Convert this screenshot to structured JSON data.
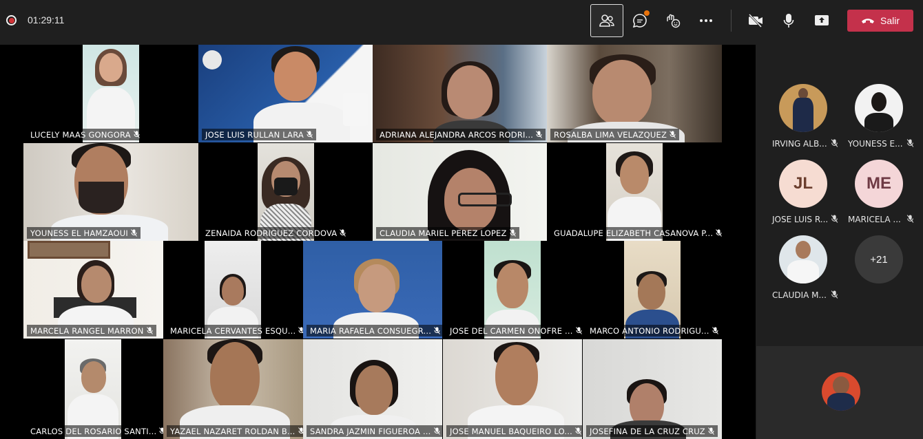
{
  "meeting": {
    "timer": "01:29:11",
    "leave_label": "Salir"
  },
  "toolbar": {
    "icons": [
      "participants-icon",
      "chat-icon",
      "reactions-icon",
      "more-icon",
      "camera-off-icon",
      "mic-icon",
      "share-icon"
    ]
  },
  "grid": {
    "row1": [
      {
        "name": "LUCELY MAAS GONGORA"
      },
      {
        "name": "JOSE LUIS RULLAN LARA"
      },
      {
        "name": "ADRIANA ALEJANDRA ARCOS RODRI..."
      },
      {
        "name": "ROSALBA LIMA VELAZQUEZ"
      }
    ],
    "row2": [
      {
        "name": "YOUNESS EL HAMZAOUI"
      },
      {
        "name": "ZENAIDA RODRIGUEZ CORDOVA"
      },
      {
        "name": "CLAUDIA MARIEL PEREZ LOPEZ"
      },
      {
        "name": "GUADALUPE ELIZABETH CASANOVA P..."
      }
    ],
    "row3": [
      {
        "name": "MARCELA RANGEL MARRON"
      },
      {
        "name": "MARICELA CERVANTES ESQU..."
      },
      {
        "name": "MARIA RAFAELA CONSUEGR..."
      },
      {
        "name": "JOSE DEL CARMEN ONOFRE ..."
      },
      {
        "name": "MARCO ANTONIO RODRIGU..."
      }
    ],
    "row4": [
      {
        "name": "CARLOS DEL ROSARIO SANTI..."
      },
      {
        "name": "YAZAEL NAZARET ROLDAN B..."
      },
      {
        "name": "SANDRA JAZMIN FIGUEROA ..."
      },
      {
        "name": "JOSE MANUEL BAQUEIRO LO..."
      },
      {
        "name": "JOSEFINA DE LA CRUZ CRUZ"
      }
    ]
  },
  "side_panel": {
    "participants": [
      {
        "name": "IRVING ALB...",
        "initials": ""
      },
      {
        "name": "YOUNESS E...",
        "initials": ""
      },
      {
        "name": "JOSE LUIS R...",
        "initials": "JL"
      },
      {
        "name": "MARICELA ...",
        "initials": "ME"
      },
      {
        "name": "CLAUDIA M...",
        "initials": ""
      }
    ],
    "overflow_count": "+21"
  },
  "colors": {
    "leave_button": "#c4314b",
    "background": "#1f1f1f",
    "avatar_jl": "#f6dcd2",
    "avatar_me": "#f4d6d8"
  }
}
